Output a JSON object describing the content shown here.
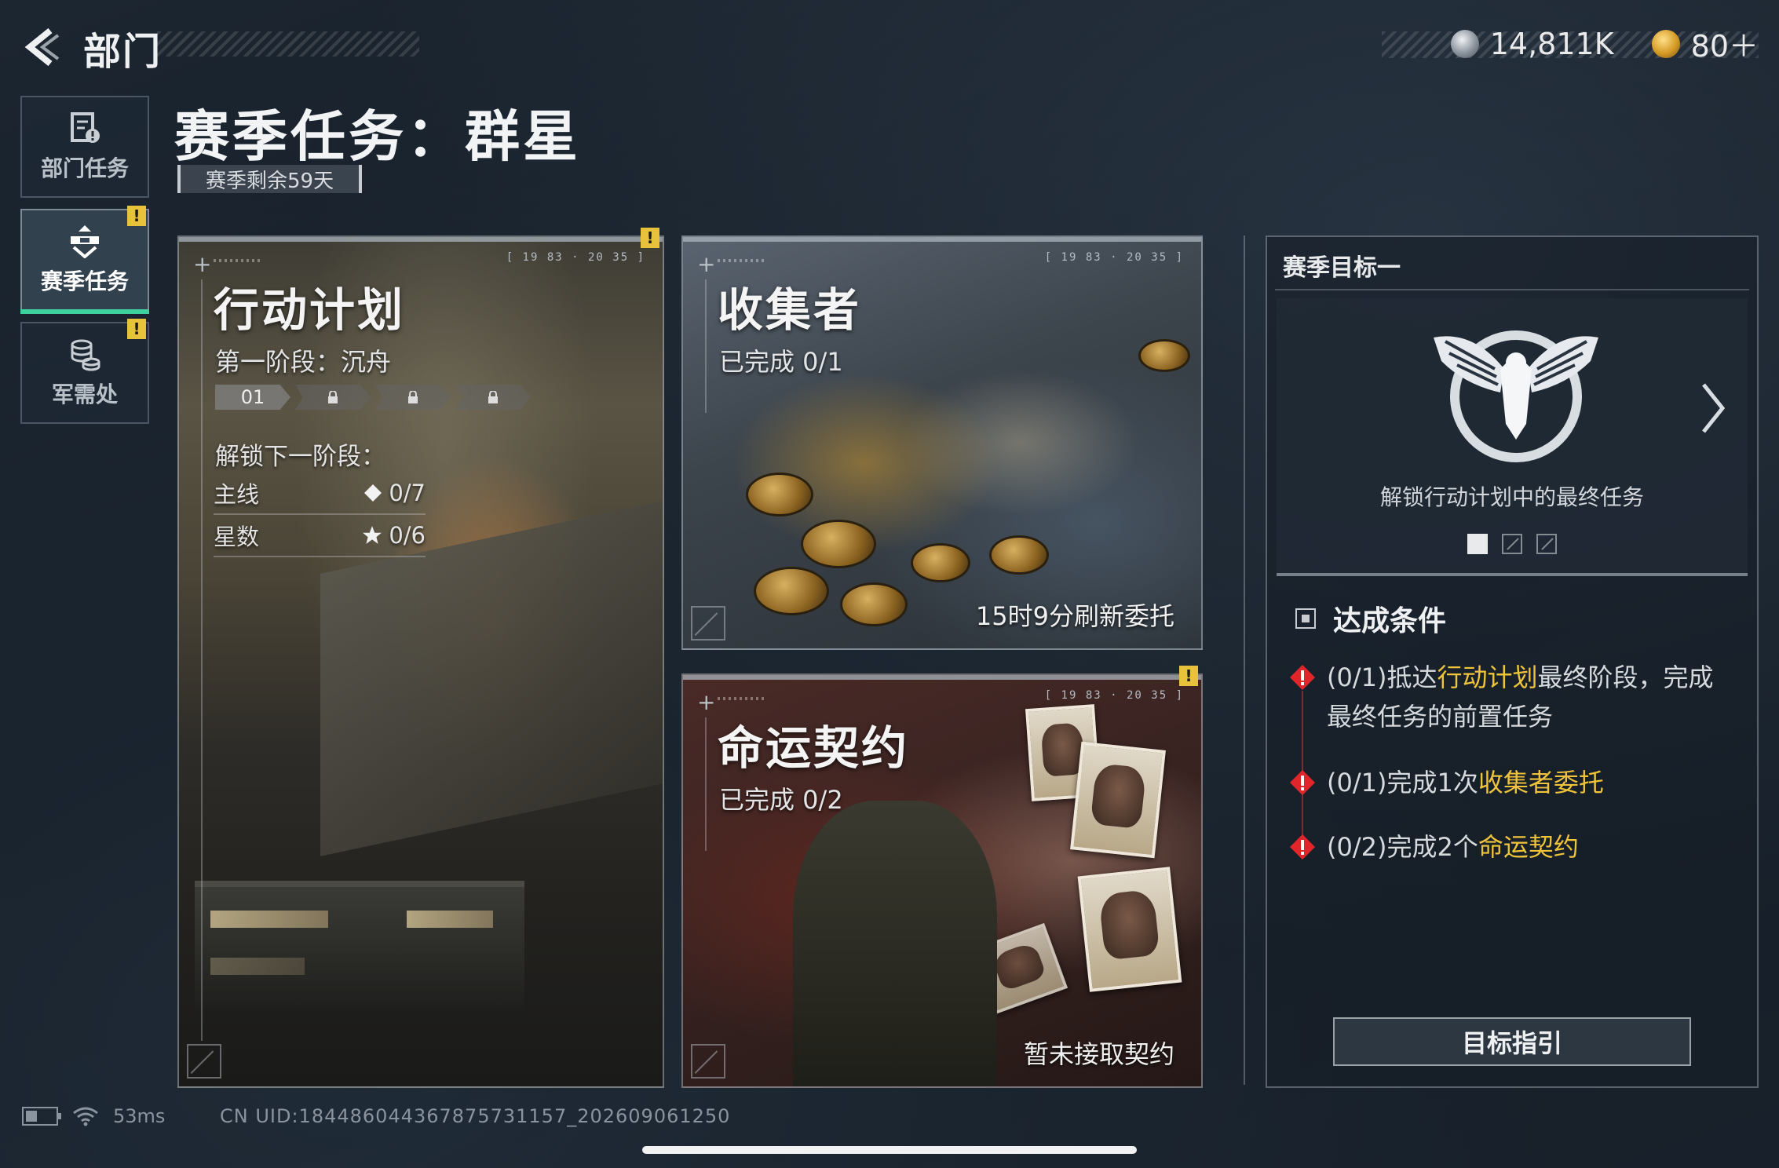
{
  "header": {
    "back_icon": "chevron-left-icon",
    "title": "部门",
    "currencies": [
      {
        "icon": "silver-coin-icon",
        "value": "14,811K"
      },
      {
        "icon": "gold-coin-icon",
        "value": "80＋"
      }
    ]
  },
  "sidebar": {
    "items": [
      {
        "label": "部门任务",
        "icon": "task-document-icon",
        "active": false,
        "alert": false
      },
      {
        "label": "赛季任务",
        "icon": "season-emblem-icon",
        "active": true,
        "alert": true
      },
      {
        "label": "军需处",
        "icon": "coin-stack-icon",
        "active": false,
        "alert": true
      }
    ],
    "alert_mark": "!"
  },
  "season": {
    "title": "赛季任务：群星",
    "remaining": "赛季剩余59天"
  },
  "cards": {
    "plan": {
      "title": "行动计划",
      "coords": "[ 19 83 · 20 35 ]",
      "subtitle": "第一阶段：沉舟",
      "stage_first": "01",
      "unlock_label": "解锁下一阶段：",
      "main_label": "主线",
      "main_value": "0/7",
      "star_label": "星数",
      "star_value": "0/6",
      "alert": "!"
    },
    "collector": {
      "title": "收集者",
      "coords": "[ 19 83 · 20 35 ]",
      "subtitle": "已完成 0/1",
      "footer": "15时9分刷新委托",
      "alert": "!"
    },
    "destiny": {
      "title": "命运契约",
      "coords": "[ 19 83 · 20 35 ]",
      "subtitle": "已完成 0/2",
      "footer": "暂未接取契约",
      "alert": "!"
    }
  },
  "goal": {
    "header": "赛季目标一",
    "emblem_icon": "eagle-emblem-icon",
    "caption": "解锁行动计划中的最终任务",
    "page_count": 3,
    "active_page": 1,
    "conditions_title": "达成条件",
    "conditions": [
      {
        "pre": "(0/1)抵达",
        "highlight": "行动计划",
        "post": "最终阶段，完成最终任务的前置任务"
      },
      {
        "pre": "(0/1)完成1次",
        "highlight": "收集者委托",
        "post": ""
      },
      {
        "pre": "(0/2)完成2个",
        "highlight": "命运契约",
        "post": ""
      }
    ],
    "guide_button": "目标指引",
    "accent_color": "#f0c43a",
    "warn_color": "#e0262a"
  },
  "status": {
    "ping": "53ms",
    "uid": "CN UID:18448604436787573​1157_202609061250"
  },
  "colors": {
    "active_tab": "#3fd0a0",
    "alert": "#e8c23a"
  }
}
